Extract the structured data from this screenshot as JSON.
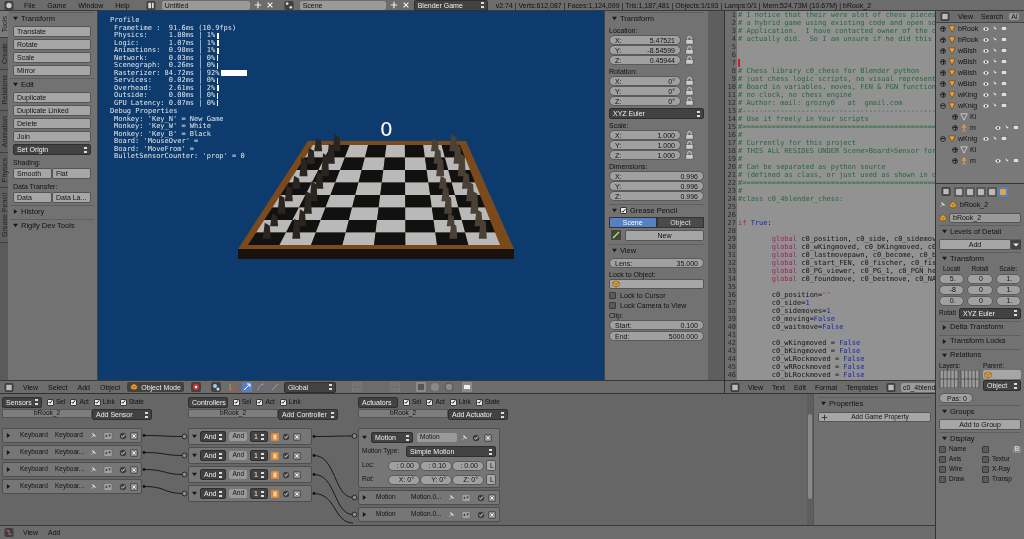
{
  "top_bar": {
    "menus": [
      "File",
      "Game",
      "Window",
      "Help"
    ],
    "screen": "Untitled",
    "scene": "Scene",
    "engine": "Blender Game",
    "status": "v2.74 | Verts:612,087 | Faces:1,124,099 | Tris:1,187,481 | Objects:1/193 | Lamps:0/1 | Mem:524.73M (10.67M) | bRook_2"
  },
  "tool_tabs": [
    {
      "label": "Tools",
      "selected": true
    },
    {
      "label": "Create",
      "selected": false
    },
    {
      "label": "Relations",
      "selected": false
    },
    {
      "label": "Animation",
      "selected": false
    },
    {
      "label": "Physics",
      "selected": false
    },
    {
      "label": "Grease Pencil",
      "selected": false
    }
  ],
  "toolshelf": [
    {
      "kind": "panel",
      "label": "Transform",
      "expanded": true
    },
    {
      "kind": "button",
      "label": "Translate"
    },
    {
      "kind": "button",
      "label": "Rotate"
    },
    {
      "kind": "button",
      "label": "Scale"
    },
    {
      "kind": "button",
      "label": "Mirror"
    },
    {
      "kind": "panel",
      "label": "Edit",
      "expanded": true
    },
    {
      "kind": "button",
      "label": "Duplicate"
    },
    {
      "kind": "button",
      "label": "Duplicate Linked"
    },
    {
      "kind": "button",
      "label": "Delete"
    },
    {
      "kind": "button",
      "label": "Join"
    },
    {
      "kind": "select",
      "label": "Set Origin"
    },
    {
      "kind": "caption",
      "label": "Shading:"
    },
    {
      "kind": "pair",
      "labels": [
        "Smooth",
        "Flat"
      ]
    },
    {
      "kind": "caption",
      "label": "Data Transfer:"
    },
    {
      "kind": "pair",
      "labels": [
        "Data",
        "Data La..."
      ]
    },
    {
      "kind": "panel",
      "label": "History",
      "expanded": false
    },
    {
      "kind": "panel",
      "label": "Rigify Dev Tools",
      "expanded": true
    }
  ],
  "viewport": {
    "profile_title": "Profile",
    "frametime": "Frametime :  91.6ms (10.9fps)",
    "profile": [
      {
        "text": "Physics:     1.80ms | 1%",
        "level": 0.01
      },
      {
        "text": "Logic:       1.07ms | 1%",
        "level": 0.01
      },
      {
        "text": "Animations:  0.98ms | 1%",
        "level": 0.01
      },
      {
        "text": "Network:     0.03ms | 0%",
        "level": 0
      },
      {
        "text": "Scenegraph:  0.26ms | 0%",
        "level": 0
      },
      {
        "text": "Rasterizer: 84.72ms | 92%",
        "level": 0.92
      },
      {
        "text": "Services:    0.02ms | 0%",
        "level": 0
      },
      {
        "text": "Overhead:    2.61ms | 2%",
        "level": 0.02
      },
      {
        "text": "Outside:     0.00ms | 0%",
        "level": 0
      },
      {
        "text": "GPU Latency: 0.07ms | 0%",
        "level": 0
      }
    ],
    "debug_title": "Debug Properties",
    "debug": [
      "Monkey: 'Key_N' = New Game",
      "Monkey: 'Key_W' = White",
      "Monkey: 'Key_B' = Black",
      "Board: 'MouseOver' =",
      "Board: 'MoveFrom' =",
      "BulletSensorCounter: 'prop' = 0"
    ],
    "score": "0"
  },
  "viewport_header": {
    "menus": [
      "View",
      "Select",
      "Add",
      "Object"
    ],
    "mode": "Object Mode",
    "orientation": "Global"
  },
  "n_panel": {
    "transform": {
      "label": "Transform",
      "expanded": true,
      "groups": [
        {
          "label": "Location:",
          "locks": true,
          "fields": [
            {
              "axis": "X:",
              "value": "5.47521"
            },
            {
              "axis": "Y:",
              "value": "-8.54599"
            },
            {
              "axis": "Z:",
              "value": "0.45944"
            }
          ]
        },
        {
          "label": "Rotation:",
          "locks": true,
          "mode": "XYZ Euler",
          "fields": [
            {
              "axis": "X:",
              "value": "0°"
            },
            {
              "axis": "Y:",
              "value": "0°"
            },
            {
              "axis": "Z:",
              "value": "0°"
            }
          ]
        },
        {
          "label": "Scale:",
          "locks": true,
          "fields": [
            {
              "axis": "X:",
              "value": "1.000"
            },
            {
              "axis": "Y:",
              "value": "1.000"
            },
            {
              "axis": "Z:",
              "value": "1.000"
            }
          ]
        },
        {
          "label": "Dimensions:",
          "locks": false,
          "fields": [
            {
              "axis": "X:",
              "value": "0.996"
            },
            {
              "axis": "Y:",
              "value": "0.996"
            },
            {
              "axis": "Z:",
              "value": "0.996"
            }
          ]
        }
      ]
    },
    "grease_pencil": {
      "label": "Grease Pencil",
      "expanded": true,
      "checked": true,
      "tabs": [
        {
          "label": "Scene",
          "selected": true
        },
        {
          "label": "Object",
          "selected": false
        }
      ],
      "new": "New"
    },
    "view": {
      "label": "View",
      "expanded": true,
      "lens": {
        "label": "Lens:",
        "value": "35.000"
      },
      "lock_label": "Lock to Object:",
      "toggles": [
        {
          "label": "Lock to Cursor",
          "checked": false
        },
        {
          "label": "Lock Camera to View",
          "checked": false
        }
      ],
      "clip_label": "Clip:",
      "clip": [
        {
          "label": "Start:",
          "value": "0.100"
        },
        {
          "label": "End:",
          "value": "5000.000"
        }
      ]
    }
  },
  "text_editor": {
    "lines": [
      {
        "num": "1",
        "cursor": false,
        "parts": [
          {
            "kind": "comment",
            "text": "# I notice that their were alot of chess pieces"
          }
        ]
      },
      {
        "num": "2",
        "cursor": false,
        "parts": [
          {
            "kind": "comment",
            "text": "# a hybrid game using existing code and open so"
          }
        ]
      },
      {
        "num": "3",
        "cursor": false,
        "parts": [
          {
            "kind": "comment",
            "text": "# Application.  I have contacted owner of the c"
          }
        ]
      },
      {
        "num": "4",
        "cursor": false,
        "parts": [
          {
            "kind": "comment",
            "text": "# actually did.  So I am unsure if he did this"
          }
        ]
      },
      {
        "num": "5",
        "cursor": false
      },
      {
        "num": "6",
        "cursor": false
      },
      {
        "num": "7",
        "cursor": true
      },
      {
        "num": "8",
        "cursor": false,
        "parts": [
          {
            "kind": "comment",
            "text": "# Chess library c0_chess for Blender python"
          }
        ]
      },
      {
        "num": "9",
        "cursor": false,
        "parts": [
          {
            "kind": "comment",
            "text": "# just chess logic scripts, no visual represent"
          }
        ]
      },
      {
        "num": "10",
        "cursor": false,
        "parts": [
          {
            "kind": "comment",
            "text": "# Board in variables, moves, FEN & PGN function"
          }
        ]
      },
      {
        "num": "11",
        "cursor": false,
        "parts": [
          {
            "kind": "comment",
            "text": "# no clock, no chess engine"
          }
        ]
      },
      {
        "num": "12",
        "cursor": false,
        "parts": [
          {
            "kind": "comment",
            "text": "# Author: mail: grozny0   at  gmail.com"
          }
        ]
      },
      {
        "num": "13",
        "cursor": false,
        "parts": [
          {
            "kind": "comment",
            "text": "#----------------------------------------------"
          }
        ]
      },
      {
        "num": "14",
        "cursor": false,
        "parts": [
          {
            "kind": "comment",
            "text": "# Use it freely in Your scripts"
          }
        ]
      },
      {
        "num": "15",
        "cursor": false,
        "parts": [
          {
            "kind": "comment",
            "text": "#=============================================="
          }
        ]
      },
      {
        "num": "16",
        "cursor": false,
        "parts": [
          {
            "kind": "comment",
            "text": "#"
          }
        ]
      },
      {
        "num": "17",
        "cursor": false,
        "parts": [
          {
            "kind": "comment",
            "text": "# Currently for this project"
          }
        ]
      },
      {
        "num": "18",
        "cursor": false,
        "parts": [
          {
            "kind": "comment",
            "text": "# THIS ALL RESIDES UNDER Scene>Board>Sensor for"
          }
        ]
      },
      {
        "num": "19",
        "cursor": false,
        "parts": [
          {
            "kind": "comment",
            "text": "#"
          }
        ]
      },
      {
        "num": "20",
        "cursor": false,
        "parts": [
          {
            "kind": "comment",
            "text": "# Can be separated as python source"
          }
        ]
      },
      {
        "num": "21",
        "cursor": false,
        "parts": [
          {
            "kind": "comment",
            "text": "# (defined as class, or just used as shown in c"
          }
        ]
      },
      {
        "num": "22",
        "cursor": false,
        "parts": [
          {
            "kind": "comment",
            "text": "#=============================================="
          }
        ]
      },
      {
        "num": "23",
        "cursor": false,
        "parts": [
          {
            "kind": "comment",
            "text": "#"
          }
        ]
      },
      {
        "num": "24",
        "cursor": false,
        "parts": [
          {
            "kind": "comment",
            "text": "#class c0_4blender_chess:"
          }
        ]
      },
      {
        "num": "25",
        "cursor": false
      },
      {
        "num": "26",
        "cursor": false
      },
      {
        "num": "27",
        "cursor": false,
        "parts": [
          {
            "kind": "keyword",
            "text": "if"
          },
          {
            "kind": "const",
            "text": " True"
          },
          {
            "kind": "name",
            "text": ":"
          }
        ]
      },
      {
        "num": "28",
        "cursor": false
      },
      {
        "num": "29",
        "cursor": false,
        "parts": [
          {
            "kind": "keyword",
            "text": "        global"
          },
          {
            "kind": "name",
            "text": " c0_position, c0_side, c0_sidemov"
          }
        ]
      },
      {
        "num": "30",
        "cursor": false,
        "parts": [
          {
            "kind": "keyword",
            "text": "        global"
          },
          {
            "kind": "name",
            "text": " c0_wKingmoved, c0_bKingmoved, c0"
          }
        ]
      },
      {
        "num": "31",
        "cursor": false,
        "parts": [
          {
            "kind": "keyword",
            "text": "        global"
          },
          {
            "kind": "name",
            "text": " c0_lastmovepawn, c0_become, c0_b"
          }
        ]
      },
      {
        "num": "32",
        "cursor": false,
        "parts": [
          {
            "kind": "keyword",
            "text": "        global"
          },
          {
            "kind": "name",
            "text": " c0_start_FEN, c0_fischer, c0_fis"
          }
        ]
      },
      {
        "num": "33",
        "cursor": false,
        "parts": [
          {
            "kind": "keyword",
            "text": "        global"
          },
          {
            "kind": "name",
            "text": " c0_PG_viewer, c0_PG_1, c0_PGN_he"
          }
        ]
      },
      {
        "num": "34",
        "cursor": false,
        "parts": [
          {
            "kind": "keyword",
            "text": "        global"
          },
          {
            "kind": "name",
            "text": " c0_foundmove, c0_bestmove, c0_NA"
          }
        ]
      },
      {
        "num": "35",
        "cursor": false
      },
      {
        "num": "36",
        "cursor": false,
        "parts": [
          {
            "kind": "name",
            "text": "        c0_position="
          },
          {
            "kind": "string",
            "text": "\"\""
          }
        ]
      },
      {
        "num": "37",
        "cursor": false,
        "parts": [
          {
            "kind": "name",
            "text": "        c0_side="
          },
          {
            "kind": "const",
            "text": "1"
          }
        ]
      },
      {
        "num": "38",
        "cursor": false,
        "parts": [
          {
            "kind": "name",
            "text": "        c0_sidemoves="
          },
          {
            "kind": "const",
            "text": "1"
          }
        ]
      },
      {
        "num": "39",
        "cursor": false,
        "parts": [
          {
            "kind": "name",
            "text": "        c0_moving="
          },
          {
            "kind": "const",
            "text": "False"
          }
        ]
      },
      {
        "num": "40",
        "cursor": false,
        "parts": [
          {
            "kind": "name",
            "text": "        c0_waitmove="
          },
          {
            "kind": "const",
            "text": "False"
          }
        ]
      },
      {
        "num": "41",
        "cursor": false
      },
      {
        "num": "42",
        "cursor": false,
        "parts": [
          {
            "kind": "name",
            "text": "        c0_wKingmoved = "
          },
          {
            "kind": "const",
            "text": "False"
          }
        ]
      },
      {
        "num": "43",
        "cursor": false,
        "parts": [
          {
            "kind": "name",
            "text": "        c0_bKingmoved = "
          },
          {
            "kind": "const",
            "text": "False"
          }
        ]
      },
      {
        "num": "44",
        "cursor": false,
        "parts": [
          {
            "kind": "name",
            "text": "        c0_wLRockmoved = "
          },
          {
            "kind": "const",
            "text": "False"
          }
        ]
      },
      {
        "num": "45",
        "cursor": false,
        "parts": [
          {
            "kind": "name",
            "text": "        c0_wRRockmoved = "
          },
          {
            "kind": "const",
            "text": "False"
          }
        ]
      },
      {
        "num": "46",
        "cursor": false,
        "parts": [
          {
            "kind": "name",
            "text": "        c0_bLRockmoved = "
          },
          {
            "kind": "const",
            "text": "False"
          }
        ]
      }
    ]
  },
  "text_header": {
    "menus": [
      "View",
      "Text",
      "Edit",
      "Format",
      "Templates"
    ],
    "file": "c0_4blend"
  },
  "logic": {
    "sensors": {
      "menu": "Sensors",
      "filters": [
        {
          "label": "Sel",
          "checked": true
        },
        {
          "label": "Act",
          "checked": true
        },
        {
          "label": "Link",
          "checked": true
        },
        {
          "label": "State",
          "checked": true
        }
      ],
      "object": "bRook_2",
      "add": "Add Sensor",
      "bricks": [
        {
          "type": "Keyboard",
          "name": "Keyboard",
          "expanded": false
        },
        {
          "type": "Keyboard",
          "name": "Keyboar...",
          "expanded": false
        },
        {
          "type": "Keyboard",
          "name": "Keyboar...",
          "expanded": false
        },
        {
          "type": "Keyboard",
          "name": "Keyboar...",
          "expanded": false
        }
      ]
    },
    "controllers": {
      "menu": "Controllers",
      "filters": [
        {
          "label": "Sel",
          "checked": true
        },
        {
          "label": "Act",
          "checked": true
        },
        {
          "label": "Link",
          "checked": true
        }
      ],
      "object": "bRook_2",
      "add": "Add Controller",
      "bricks": [
        {
          "type": "And",
          "name": "And",
          "state": "1",
          "expanded": true
        },
        {
          "type": "And",
          "name": "And",
          "state": "1",
          "expanded": true
        },
        {
          "type": "And",
          "name": "And",
          "state": "1",
          "expanded": true
        },
        {
          "type": "And",
          "name": "And",
          "state": "1",
          "expanded": true
        }
      ]
    },
    "actuators": {
      "menu": "Actuators",
      "filters": [
        {
          "label": "Sel",
          "checked": true
        },
        {
          "label": "Act",
          "checked": true
        },
        {
          "label": "Link",
          "checked": true
        },
        {
          "label": "State",
          "checked": true
        }
      ],
      "object": "bRook_2",
      "add": "Add Actuator",
      "bricks": [
        {
          "type": "Motion",
          "name": "Motion",
          "expanded": true,
          "motion_type_label": "Motion Type:",
          "motion_type": "Simple Motion",
          "rows": [
            {
              "label": "Loc:",
              "values": [
                ": 0.00",
                ": 0.10",
                ": 0.00"
              ],
              "local": "L"
            },
            {
              "label": "Rot:",
              "values": [
                "X:  0°",
                "Y:  0°",
                "Z:  0°"
              ],
              "local": "L"
            }
          ]
        },
        {
          "type": "Motion",
          "name": "Motion.0...",
          "expanded": false
        },
        {
          "type": "Motion",
          "name": "Motion.0...",
          "expanded": false
        }
      ]
    },
    "game_properties": {
      "label": "Properties",
      "expanded": true,
      "add": "Add Game Property"
    }
  },
  "logic_header": {
    "menus": [
      "View",
      "Add"
    ]
  },
  "outliner": {
    "menus": [
      "View",
      "Search"
    ],
    "filter": "Al",
    "items": [
      {
        "name": "bRook",
        "expanded": false
      },
      {
        "name": "bRook",
        "expanded": false
      },
      {
        "name": "wBish",
        "expanded": false
      },
      {
        "name": "wBish",
        "expanded": false
      },
      {
        "name": "wBish",
        "expanded": false
      },
      {
        "name": "wBish",
        "expanded": false
      },
      {
        "name": "wKing",
        "expanded": false
      },
      {
        "name": "wKnig",
        "expanded": true,
        "children": [
          {
            "name": "Ki",
            "kind": "mesh-data",
            "expanded": false
          },
          {
            "name": "m",
            "kind": "armature",
            "expanded": false
          }
        ]
      },
      {
        "name": "wKnig",
        "expanded": true,
        "children": [
          {
            "name": "Ki",
            "kind": "mesh-data",
            "expanded": false
          },
          {
            "name": "m",
            "kind": "armature",
            "expanded": false
          }
        ]
      }
    ]
  },
  "properties": {
    "context_tabs": [
      {
        "kind": "render",
        "selected": false
      },
      {
        "kind": "layers",
        "selected": false
      },
      {
        "kind": "scene",
        "selected": false
      },
      {
        "kind": "world",
        "selected": false
      },
      {
        "kind": "object",
        "selected": true
      }
    ],
    "breadcrumb": "bRook_2",
    "name": "bRook_2",
    "lod": {
      "label": "Levels of Detail",
      "expanded": true,
      "add": "Add"
    },
    "transform": {
      "label": "Transform",
      "expanded": true,
      "columns": [
        {
          "label": "Locati",
          "values": [
            "5.",
            "-8",
            "0."
          ]
        },
        {
          "label": "Rotati",
          "values": [
            "0",
            "0",
            "0"
          ]
        },
        {
          "label": "Scale:",
          "values": [
            "1.",
            "1.",
            "1."
          ]
        }
      ],
      "mode_label": "Rotati",
      "mode": "XYZ Euler"
    },
    "closed_panels": [
      {
        "label": "Delta Transform",
        "expanded": false
      },
      {
        "label": "Transform Locks",
        "expanded": false
      }
    ],
    "relations": {
      "label": "Relations",
      "expanded": true,
      "layers_label": "Layers:",
      "parent_label": "Parent:",
      "parent_type": "Object",
      "pass": "Pas: 0"
    },
    "groups": {
      "label": "Groups",
      "expanded": true,
      "add": "Add to Group"
    },
    "display": {
      "label": "Display",
      "expanded": true,
      "left": [
        {
          "label": "Name",
          "checked": false
        },
        {
          "label": "Axis",
          "checked": false
        },
        {
          "label": "Wire",
          "checked": false
        },
        {
          "label": "Draw",
          "checked": false
        }
      ],
      "bounds": {
        "checked": false,
        "type": "B"
      },
      "right": [
        {
          "label": "Textur",
          "checked": false
        },
        {
          "label": "X-Ray",
          "checked": false
        },
        {
          "label": "Transp",
          "checked": false
        }
      ]
    }
  }
}
